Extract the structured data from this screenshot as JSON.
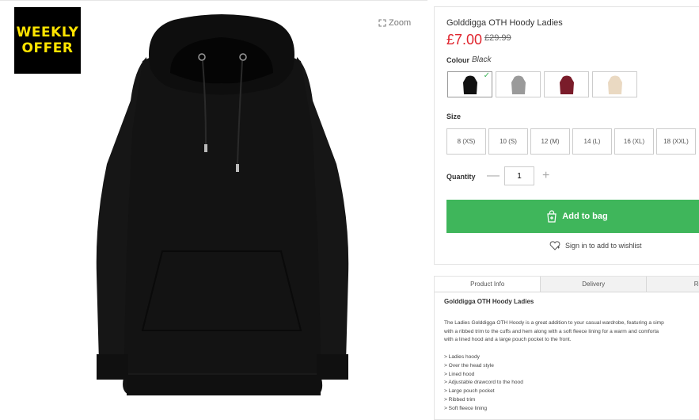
{
  "badge": {
    "line1": "WEEKLY",
    "line2": "OFFER"
  },
  "zoom_label": "Zoom",
  "product": {
    "title": "Golddigga OTH Hoody Ladies",
    "price": "£7.00",
    "was_price": "£29.99"
  },
  "colour": {
    "label": "Colour",
    "value": "Black",
    "swatches": [
      {
        "name": "Black",
        "hex": "#111111",
        "selected": true
      },
      {
        "name": "Grey",
        "hex": "#9a9a9a",
        "selected": false
      },
      {
        "name": "Burgundy",
        "hex": "#7a1c2a",
        "selected": false
      },
      {
        "name": "Cream",
        "hex": "#ead9c2",
        "selected": false
      }
    ]
  },
  "size": {
    "label": "Size",
    "options": [
      "8 (XS)",
      "10 (S)",
      "12 (M)",
      "14 (L)",
      "16 (XL)",
      "18 (XXL)"
    ]
  },
  "quantity": {
    "label": "Quantity",
    "value": "1"
  },
  "add_to_bag": "Add to bag",
  "wishlist": "Sign in to add to wishlist",
  "tabs": [
    "Product Info",
    "Delivery",
    "Re"
  ],
  "details": {
    "title": "Golddigga OTH Hoody Ladies",
    "body": [
      "The Ladies Golddigga OTH Hoody is a great addition to your casual wardrobe, featuring a simp",
      "with a ribbed trim to the cuffs and hem along with a soft fleece lining for a warm and comforta",
      "with a lined hood and a large pouch pocket to the front."
    ],
    "features": [
      "> Ladies hoody",
      "> Over the head style",
      "> Lined hood",
      "> Adjustable drawcord to the hood",
      "> Large pouch pocket",
      "> Ribbed trim",
      "> Soft fleece lining"
    ]
  },
  "colors": {
    "accent_green": "#3fb65b",
    "price_red": "#e0262f",
    "badge_yellow": "#ffe400"
  }
}
